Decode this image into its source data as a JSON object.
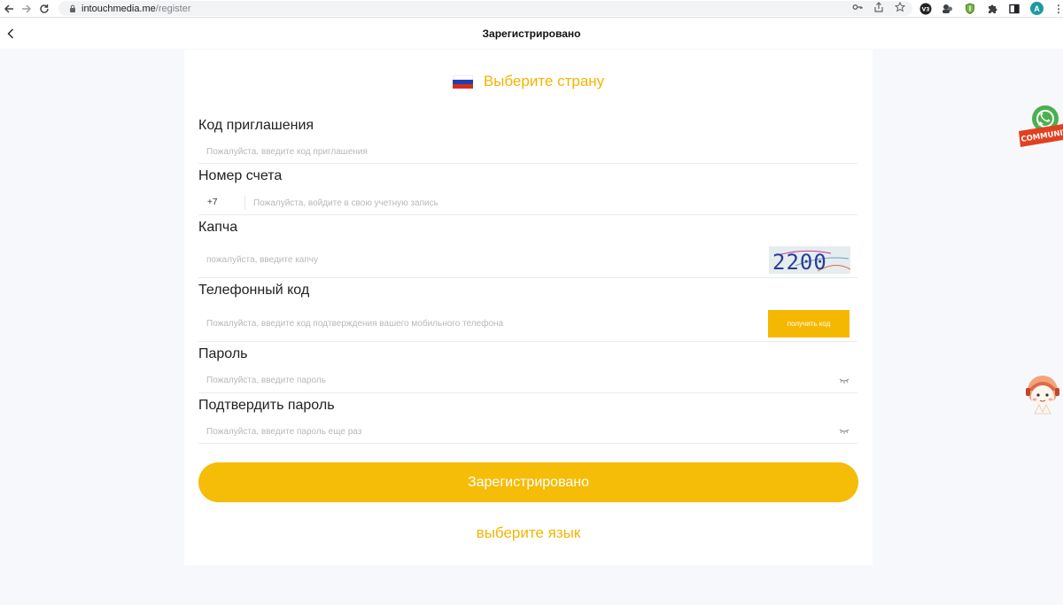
{
  "browser": {
    "url_host": "intouchmedia.me",
    "url_path": "/register",
    "profile_initial": "A",
    "ext_badge": "V3"
  },
  "header": {
    "title": "Зарегистрировано"
  },
  "country": {
    "label": "Выберите страну",
    "flag_colors": [
      "#ffffff",
      "#1c3fb0",
      "#d52b1e"
    ]
  },
  "fields": {
    "invite": {
      "label": "Код приглашения",
      "placeholder": "Пожалуйста, введите код приглашения",
      "value": ""
    },
    "account": {
      "label": "Номер счета",
      "prefix": "+7",
      "placeholder": "Пожалуйста, войдите в свою учетную запись",
      "value": ""
    },
    "captcha": {
      "label": "Капча",
      "placeholder": "пожалуйста, введите капчу",
      "value": "",
      "image_text": "2200"
    },
    "phone_code": {
      "label": "Телефонный код",
      "placeholder": "Пожалуйста, введите код подтверждения вашего мобильного телефона",
      "value": "",
      "button_label": "получить код"
    },
    "password": {
      "label": "Пароль",
      "placeholder": "Пожалуйста, введите пароль",
      "value": ""
    },
    "confirm_password": {
      "label": "Подтвердить пароль",
      "placeholder": "Пожалуйста, введите пароль еще раз",
      "value": ""
    }
  },
  "submit_label": "Зарегистрировано",
  "language_link": "выберите язык",
  "community_badge": "COMMUNITY",
  "colors": {
    "accent": "#f5b800",
    "page_bg": "#f7f8fc"
  }
}
